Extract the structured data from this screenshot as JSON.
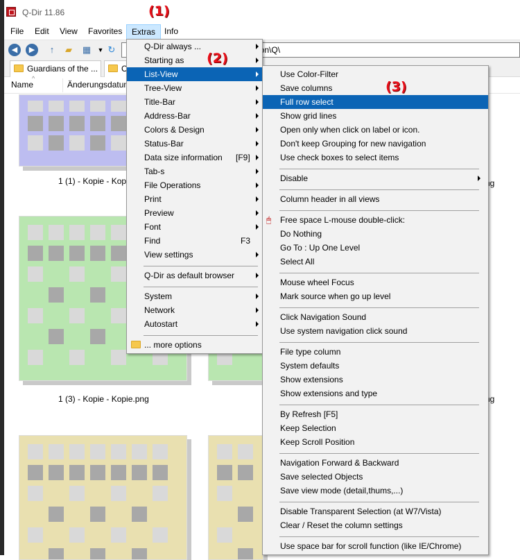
{
  "window": {
    "title": "Q-Dir 11.86"
  },
  "menubar": [
    "File",
    "Edit",
    "View",
    "Favorites",
    "Extras",
    "Info"
  ],
  "address": {
    "path_tail": "g\\icon\\Q\\"
  },
  "tabs": {
    "tab1": "Guardians of the ...",
    "tab2": "C"
  },
  "columns": {
    "name": "Name",
    "date": "Änderungsdatum"
  },
  "files": [
    "1 (1) - Kopie - Kopi",
    "ng",
    "1 (3) - Kopie - Kopie.png",
    "ng"
  ],
  "annotations": [
    "(1)",
    "(2)",
    "(3)"
  ],
  "extras_menu": {
    "items": [
      {
        "label": "Q-Dir always ...",
        "sub": true
      },
      {
        "label": "Starting as",
        "sub": true
      },
      {
        "label": "List-View",
        "sub": true,
        "highlighted": true
      },
      {
        "label": "Tree-View",
        "sub": true
      },
      {
        "label": "Title-Bar",
        "sub": true
      },
      {
        "label": "Address-Bar",
        "sub": true
      },
      {
        "label": "Colors & Design",
        "sub": true
      },
      {
        "label": "Status-Bar",
        "sub": true
      },
      {
        "label": "Data size information",
        "shortcut": "[F9]",
        "sub": true
      },
      {
        "label": "Tab-s",
        "sub": true
      },
      {
        "label": "File Operations",
        "sub": true
      },
      {
        "label": "Print",
        "sub": true
      },
      {
        "label": "Preview",
        "sub": true
      },
      {
        "label": "Font",
        "sub": true
      },
      {
        "label": "Find",
        "shortcut": "F3"
      },
      {
        "label": "View settings",
        "sub": true
      },
      {
        "label": "Q-Dir as default browser",
        "sub": true
      },
      {
        "label": "System",
        "sub": true
      },
      {
        "label": "Network",
        "sub": true
      },
      {
        "label": "Autostart",
        "sub": true
      },
      {
        "label": "... more options"
      }
    ]
  },
  "listview_menu": {
    "items": [
      "Use Color-Filter",
      "Save columns",
      "Full row select",
      "Show grid lines",
      "Open only when click on label or icon.",
      "Don't keep Grouping for new navigation",
      "Use check boxes to select items",
      "Disable",
      "Column header in all views",
      "Free space L-mouse double-click:",
      "Do Nothing",
      "Go To : Up One Level",
      "Select All",
      "Mouse wheel Focus",
      "Mark source when go up level",
      "Click Navigation Sound",
      "Use system navigation click sound",
      "File type column",
      "System defaults",
      "Show extensions",
      "Show extensions and type",
      "By Refresh [F5]",
      "Keep Selection",
      "Keep Scroll Position",
      "Navigation Forward & Backward",
      "Save selected Objects",
      "Save view mode (detail,thums,...)",
      "Disable Transparent Selection (at W7/Vista)",
      "Clear / Reset the column settings",
      "Use space bar for scroll function (like IE/Chrome)"
    ]
  },
  "colors": {
    "highlight": "#0b64b5",
    "menu_bg": "#f2f2f2",
    "annotation": "#e8111b",
    "purple_tile": "#bdbdf0",
    "green_tile": "#b9e6b0",
    "yellow_tile": "#e9e0b0"
  }
}
